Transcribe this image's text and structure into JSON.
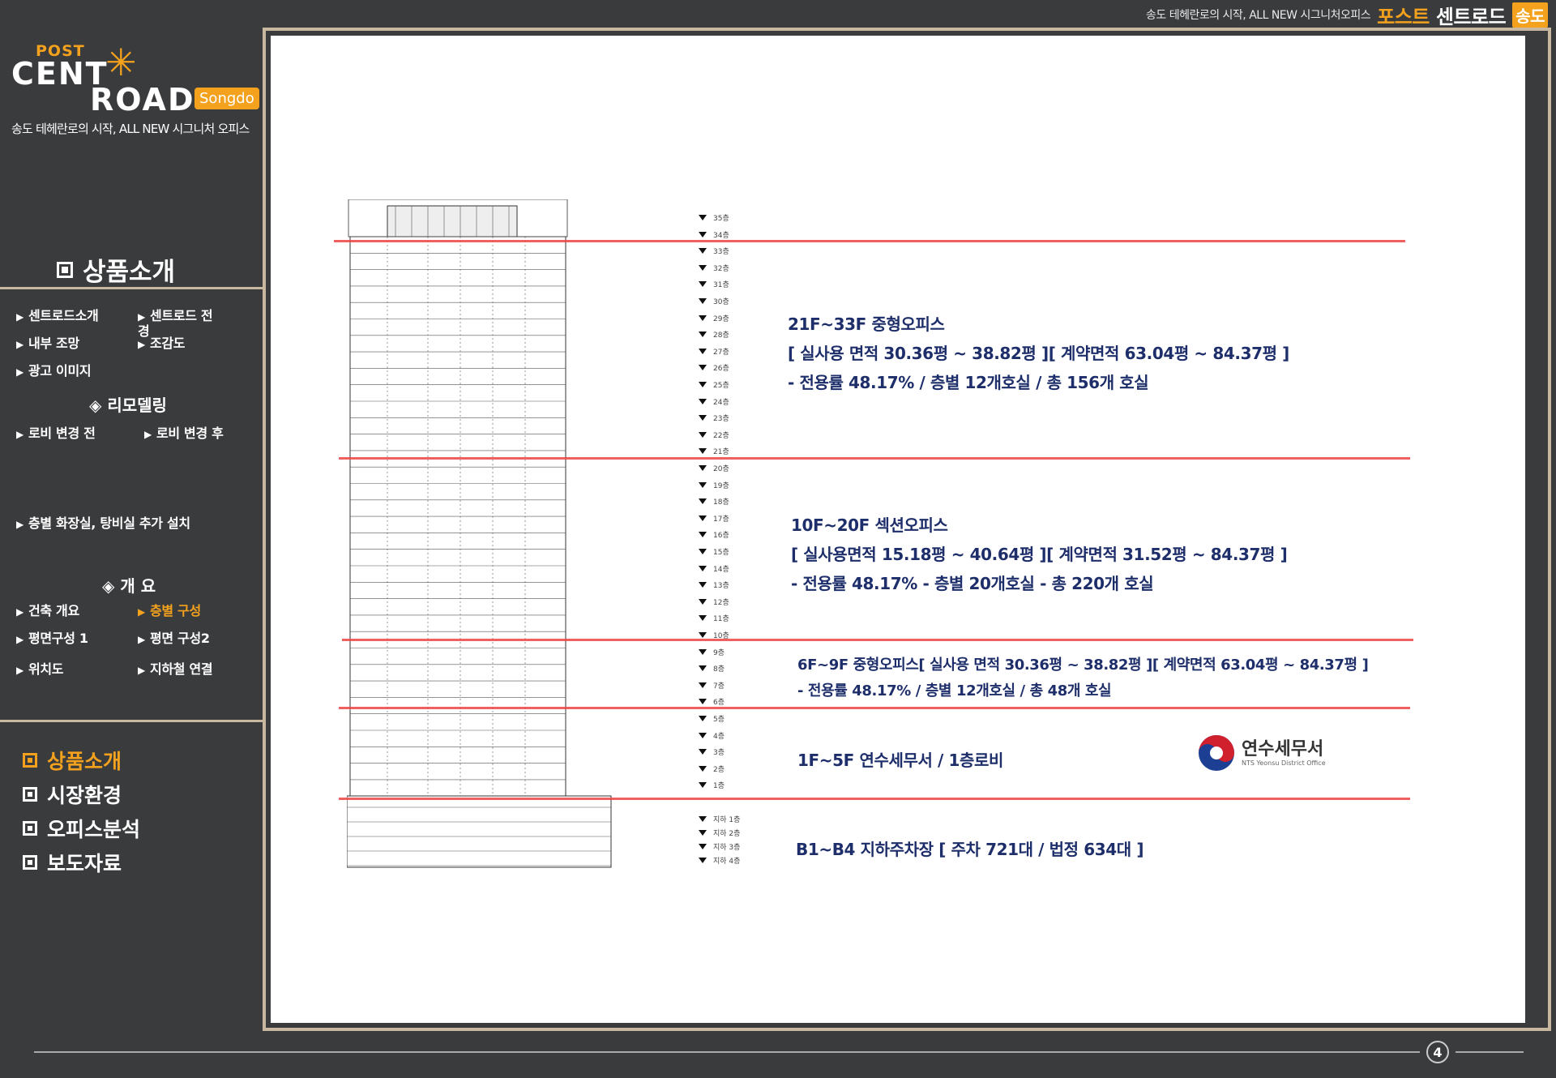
{
  "top_bar": {
    "tagline": "송도 테헤란로의 시작, ALL NEW 시그니처오피스",
    "brand_part1": "포스트",
    "brand_part2": "센트로드",
    "badge": "송도"
  },
  "logo": {
    "post": "POST",
    "cent": "CENT",
    "road": "ROAD",
    "songdo": "Songdo",
    "tagline": "송도 테헤란로의 시작, ALL NEW 시그니처 오피스"
  },
  "sidebar": {
    "section_title": "상품소개",
    "items": {
      "centroad_intro": "센트로드소개",
      "centroad_view": "센트로드 전경",
      "interior_view": "내부 조망",
      "birdseye": "조감도",
      "ad_image": "광고 이미지",
      "remodeling_head": "◈ 리모델링",
      "lobby_before": "로비 변경 전",
      "lobby_after": "로비 변경 후",
      "restroom": "층별 화장실, 탕비실 추가 설치",
      "overview_head": "◈ 개 요",
      "building_overview": "건축 개요",
      "floor_config": "층별 구성",
      "plan1": "평면구성 1",
      "plan2": "평면 구성2",
      "location": "위치도",
      "subway": "지하철 연결"
    },
    "main_menu": [
      "상품소개",
      "시장환경",
      "오피스분석",
      "보도자료"
    ]
  },
  "diagram": {
    "floors_above": [
      "35층",
      "34층",
      "33층",
      "32층",
      "31층",
      "30층",
      "29층",
      "28층",
      "27층",
      "26층",
      "25층",
      "24층",
      "23층",
      "22층",
      "21층",
      "20층",
      "19층",
      "18층",
      "17층",
      "16층",
      "15층",
      "14층",
      "13층",
      "12층",
      "11층",
      "10층",
      "9층",
      "8층",
      "7층",
      "6층",
      "5층",
      "4층",
      "3층",
      "2층",
      "1층"
    ],
    "floors_below": [
      "지하 1층",
      "지하 2층",
      "지하 3층",
      "지하 4층"
    ],
    "zones": [
      {
        "lines": [
          "21F~33F 중형오피스",
          "[ 실사용 면적 30.36평 ~ 38.82평 ][ 계약면적 63.04평 ~ 84.37평 ]",
          "- 전용률 48.17% / 층별 12개호실 / 총 156개 호실"
        ]
      },
      {
        "lines": [
          "10F~20F 섹션오피스",
          "[ 실사용면적 15.18평 ~ 40.64평 ][ 계약면적 31.52평 ~ 84.37평 ]",
          "- 전용률 48.17% - 층별 20개호실 - 총 220개 호실"
        ]
      },
      {
        "lines": [
          "6F~9F 중형오피스[ 실사용 면적 30.36평 ~ 38.82평 ][ 계약면적 63.04평 ~ 84.37평 ]",
          "- 전용률 48.17% / 층별 12개호실 / 총 48개 호실"
        ]
      },
      {
        "lines": [
          "1F~5F 연수세무서 / 1층로비"
        ]
      },
      {
        "lines": [
          "B1~B4 지하주차장 [ 주차 721대 / 법정 634대 ]"
        ]
      }
    ],
    "nts_name": "연수세무서",
    "nts_en": "NTS Yeonsu District Office"
  },
  "page_number": "4"
}
